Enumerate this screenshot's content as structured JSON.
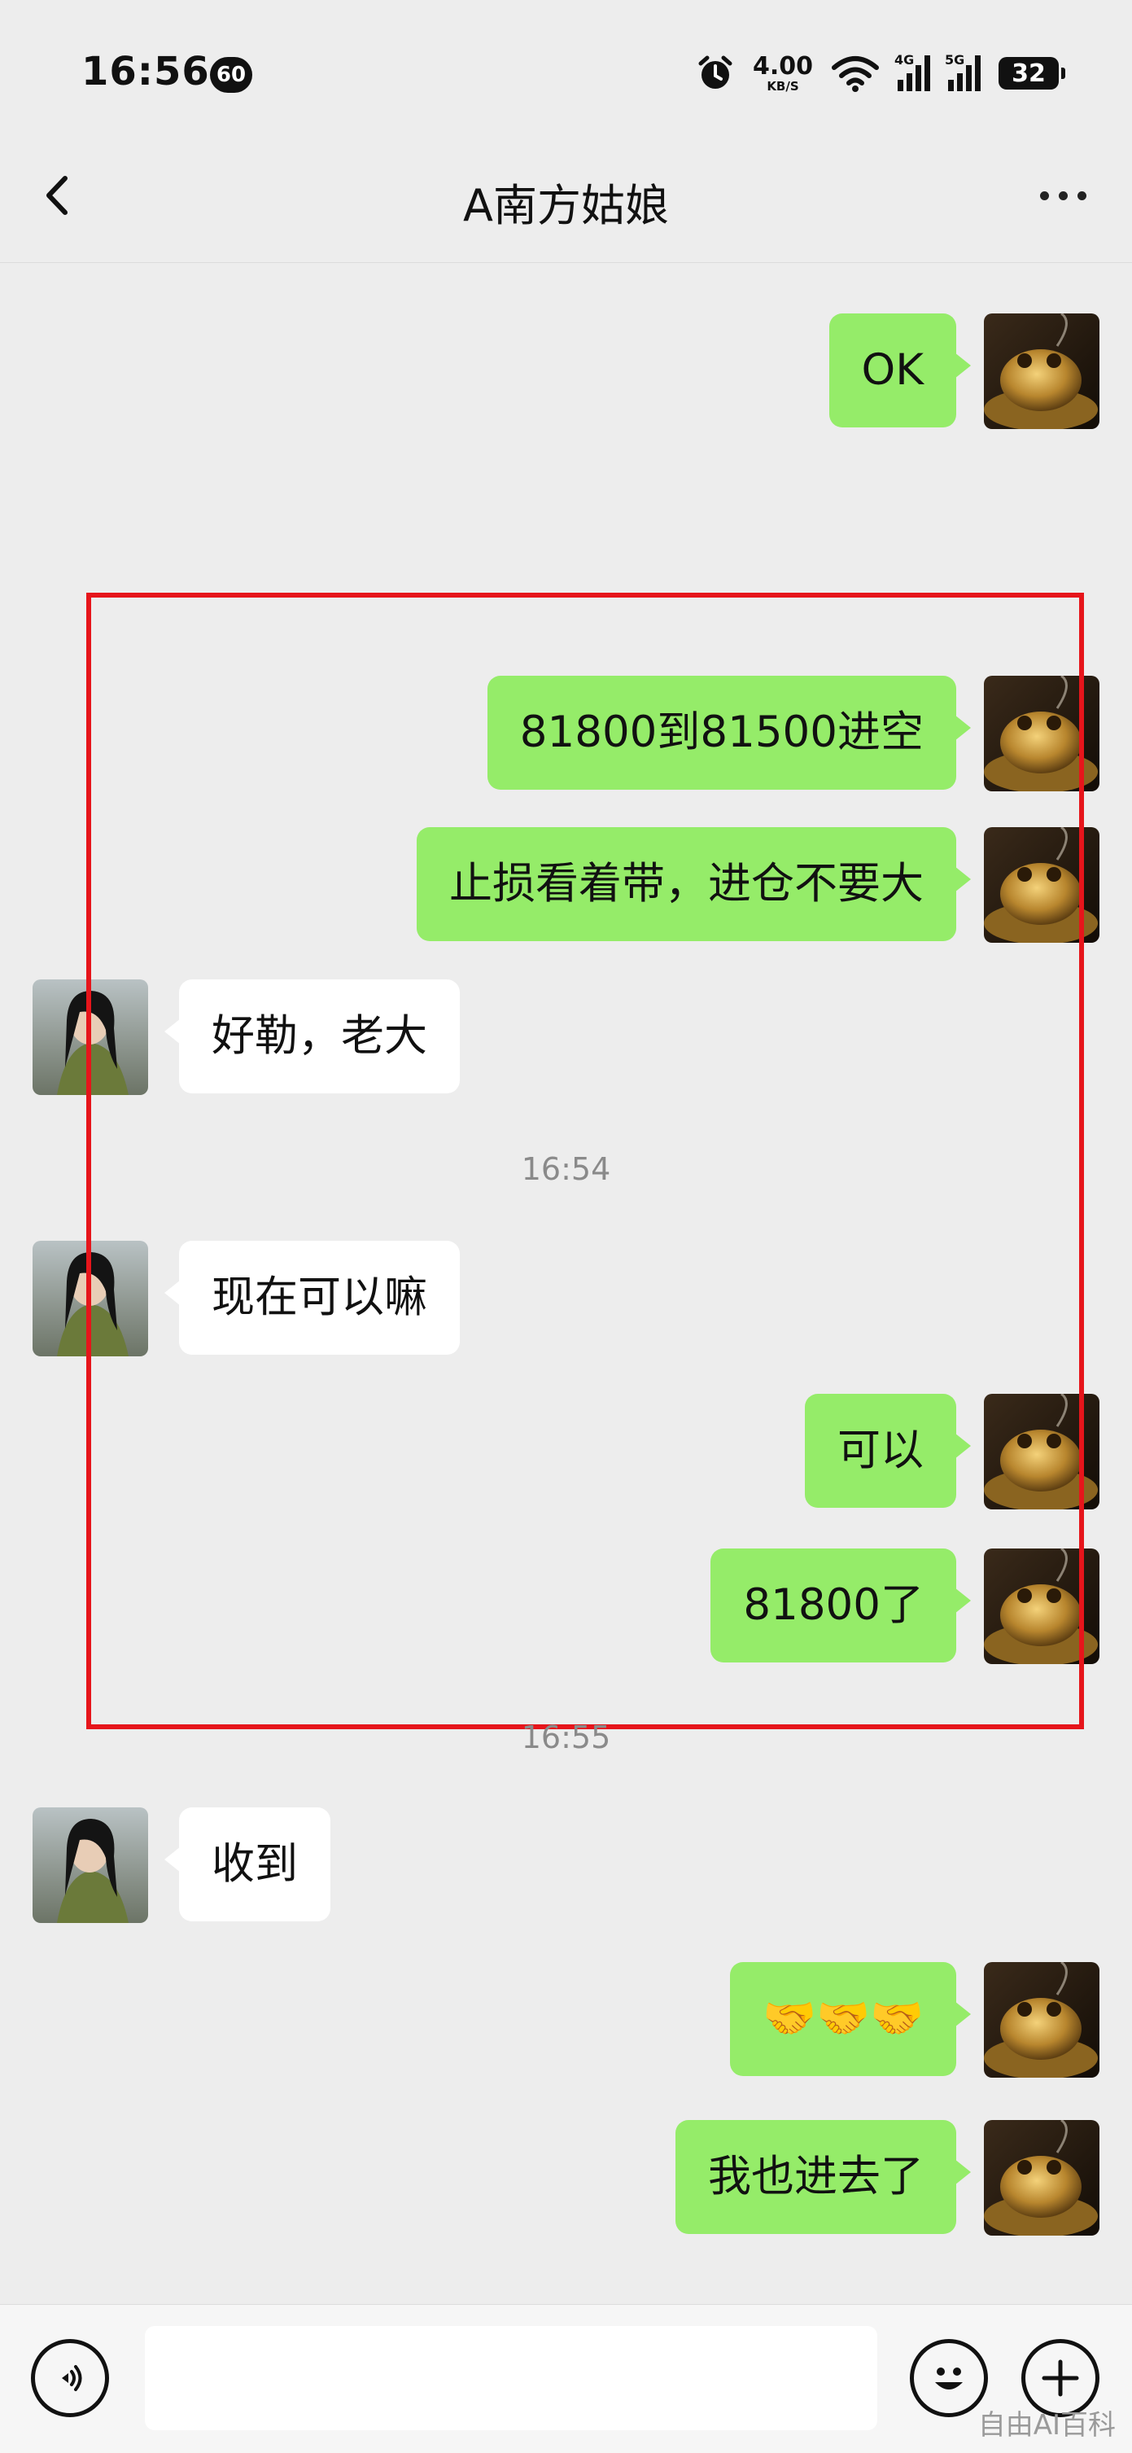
{
  "status_bar": {
    "time": "16:56",
    "notification_badge": "60",
    "net_speed_value": "4.00",
    "net_speed_unit": "KB/S",
    "signal_1_label": "4G",
    "signal_2_label": "5G",
    "battery": "32"
  },
  "header": {
    "title": "A南方姑娘",
    "back_icon": "chevron-left-icon",
    "more_icon": "more-dots-icon"
  },
  "messages": [
    {
      "side": "me",
      "text": "OK"
    },
    {
      "side": "me",
      "text": "81800到81500进空"
    },
    {
      "side": "me",
      "text": "止损看着带，进仓不要大"
    },
    {
      "side": "them",
      "text": "好勒，老大"
    },
    {
      "side": "me",
      "text": "可以"
    },
    {
      "side": "them",
      "text": "现在可以嘛"
    },
    {
      "side": "me",
      "text": "81800了"
    },
    {
      "side": "them",
      "text": "收到"
    },
    {
      "side": "me",
      "text": "🤝🤝🤝"
    },
    {
      "side": "me",
      "text": "我也进去了"
    }
  ],
  "timestamps": [
    "16:54",
    "16:55"
  ],
  "input_bar": {
    "voice_icon": "voice-icon",
    "emoji_icon": "emoji-icon",
    "plus_icon": "plus-icon",
    "input_value": "",
    "watermark": "自由AI百科"
  },
  "colors": {
    "background": "#ededed",
    "my_bubble": "#95ec69",
    "their_bubble": "#ffffff",
    "highlight_box": "#e6151b"
  }
}
